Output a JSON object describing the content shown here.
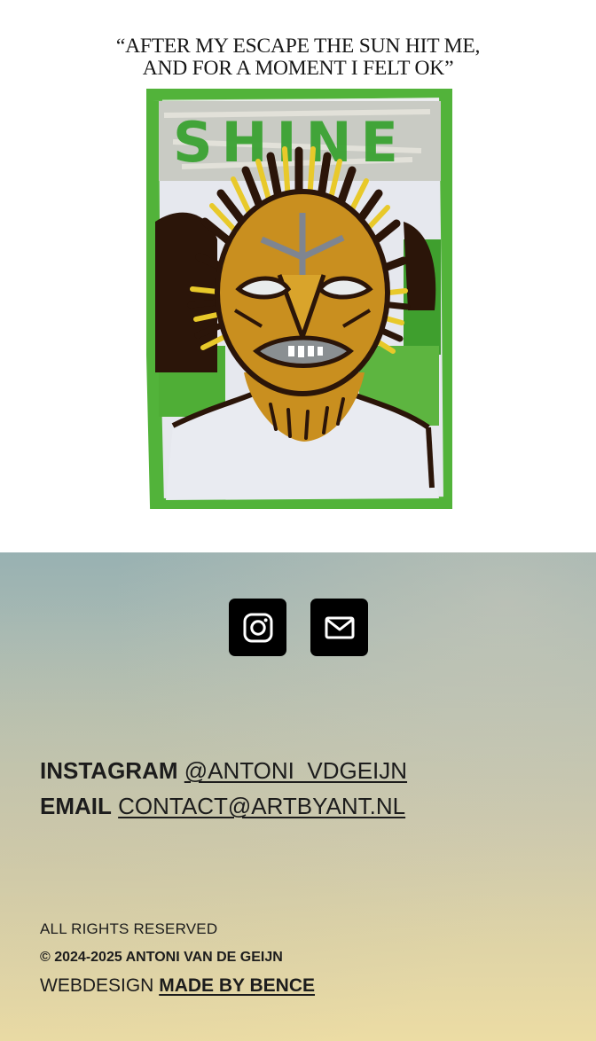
{
  "artwork": {
    "quote_line1": "“AFTER MY ESCAPE THE SUN HIT ME,",
    "quote_line2": "AND FOR A MOMENT I FELT OK”",
    "painting_text": "SHINE",
    "palette": {
      "border_green": "#52b33a",
      "paper_white": "#e6e8ee",
      "sun_ochre": "#c98f1f",
      "ray_yellow": "#e8c92a",
      "dark_brown": "#2b1509",
      "mouth_grey": "#8a8f92"
    }
  },
  "social": {
    "instagram_icon": "instagram-icon",
    "email_icon": "mail-icon",
    "button_color": "#000000"
  },
  "contact": {
    "instagram_label": "INSTAGRAM",
    "instagram_handle": "@ANTONI_VDGEIJN",
    "email_label": "EMAIL",
    "email_address": "CONTACT@ARTBYANT.NL"
  },
  "legal": {
    "rights": "ALL RIGHTS RESERVED",
    "copyright": "© 2024-2025 ANTONI VAN DE GEIJN",
    "webdesign_prefix": "WEBDESIGN",
    "webdesign_link": "MADE BY BENCE"
  },
  "colors": {
    "footer_top": "#98b1b2",
    "footer_bottom": "#ecdca4",
    "text": "#1c1c1c"
  }
}
